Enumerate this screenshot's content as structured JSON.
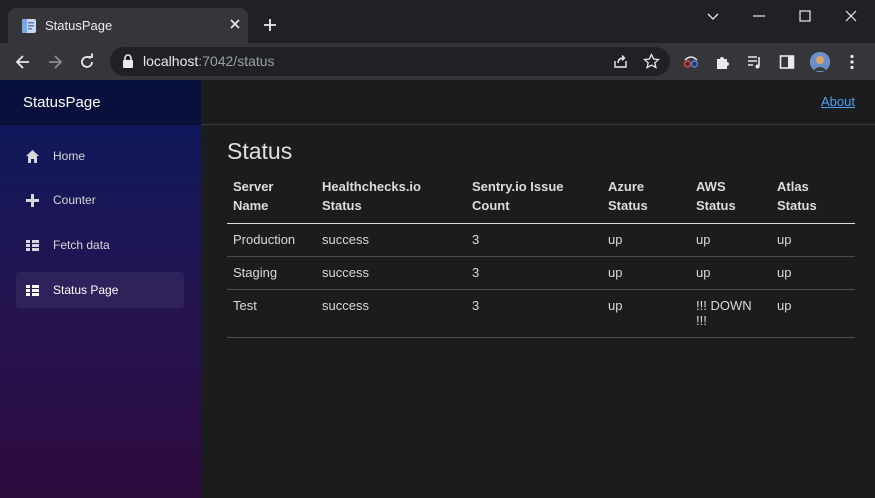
{
  "browser": {
    "tab_title": "StatusPage",
    "url_host": "localhost",
    "url_path": ":7042/status",
    "icons": [
      "page-favicon-icon",
      "close-icon",
      "plus-icon",
      "chevron-down-icon",
      "minimize-icon",
      "maximize-icon",
      "close-window-icon",
      "back-arrow-icon",
      "forward-arrow-icon",
      "reload-icon",
      "lock-icon",
      "share-icon",
      "star-icon",
      "extension-spy-icon",
      "puzzle-icon",
      "media-queue-icon",
      "side-panel-icon",
      "avatar",
      "kebab-menu-icon"
    ]
  },
  "sidebar": {
    "brand": "StatusPage",
    "items": [
      {
        "label": "Home",
        "icon": "home-icon"
      },
      {
        "label": "Counter",
        "icon": "plus-icon"
      },
      {
        "label": "Fetch data",
        "icon": "list-icon"
      },
      {
        "label": "Status Page",
        "icon": "list-icon"
      }
    ]
  },
  "topbar": {
    "about": "About"
  },
  "main": {
    "title": "Status",
    "table": {
      "headers": [
        [
          "Server",
          "Name"
        ],
        [
          "Healthchecks.io",
          "Status"
        ],
        [
          "Sentry.io Issue",
          "Count"
        ],
        [
          "Azure",
          "Status"
        ],
        [
          "AWS",
          "Status"
        ],
        [
          "Atlas",
          "Status"
        ]
      ],
      "rows": [
        [
          "Production",
          "success",
          "3",
          "up",
          "up",
          "up"
        ],
        [
          "Staging",
          "success",
          "3",
          "up",
          "up",
          "up"
        ],
        [
          "Test",
          "success",
          "3",
          "up",
          "!!! DOWN !!!",
          "up"
        ]
      ]
    }
  },
  "colors": {
    "link": "#4ea1f3",
    "sidebar_top": "#0a1a5e",
    "sidebar_bottom": "#2d0b3f",
    "background": "#1b1c1e"
  }
}
